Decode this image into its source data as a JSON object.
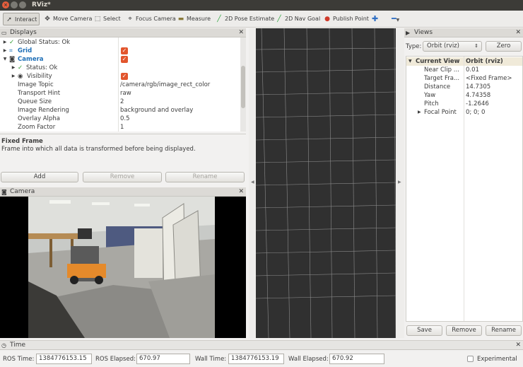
{
  "window": {
    "title": "RViz*"
  },
  "toolbar": {
    "tools": [
      {
        "icon": "cursor-icon",
        "label": "Interact",
        "active": true
      },
      {
        "icon": "move-camera-icon",
        "label": "Move Camera"
      },
      {
        "icon": "select-icon",
        "label": "Select"
      },
      {
        "icon": "focus-camera-icon",
        "label": "Focus Camera"
      },
      {
        "icon": "measure-icon",
        "label": "Measure"
      },
      {
        "icon": "pose-estimate-icon",
        "label": "2D Pose Estimate"
      },
      {
        "icon": "nav-goal-icon",
        "label": "2D Nav Goal"
      },
      {
        "icon": "publish-point-icon",
        "label": "Publish Point"
      }
    ]
  },
  "displays": {
    "title": "Displays",
    "rows": [
      {
        "key": "Global Status: Ok",
        "value": ""
      },
      {
        "key": "Grid",
        "value": ""
      },
      {
        "key": "Camera",
        "value": ""
      },
      {
        "key": "Status: Ok",
        "value": ""
      },
      {
        "key": "Visibility",
        "value": ""
      },
      {
        "key": "Image Topic",
        "value": "/camera/rgb/image_rect_color"
      },
      {
        "key": "Transport Hint",
        "value": "raw"
      },
      {
        "key": "Queue Size",
        "value": "2"
      },
      {
        "key": "Image Rendering",
        "value": "background and overlay"
      },
      {
        "key": "Overlay Alpha",
        "value": "0.5"
      },
      {
        "key": "Zoom Factor",
        "value": "1"
      }
    ],
    "help_title": "Fixed Frame",
    "help_text": "Frame into which all data is transformed before being displayed.",
    "add_label": "Add",
    "remove_label": "Remove",
    "rename_label": "Rename"
  },
  "camera_panel": {
    "title": "Camera"
  },
  "views": {
    "title": "Views",
    "type_label": "Type:",
    "type_value": "Orbit (rviz)",
    "zero_label": "Zero",
    "rows": [
      {
        "key": "Current View",
        "value": "Orbit (rviz)"
      },
      {
        "key": "Near Clip ...",
        "value": "0.01"
      },
      {
        "key": "Target Fra...",
        "value": "<Fixed Frame>"
      },
      {
        "key": "Distance",
        "value": "14.7305"
      },
      {
        "key": "Yaw",
        "value": "4.74358"
      },
      {
        "key": "Pitch",
        "value": "-1.2646"
      },
      {
        "key": "Focal Point",
        "value": "0; 0; 0"
      }
    ],
    "save_label": "Save",
    "remove_label": "Remove",
    "rename_label": "Rename"
  },
  "time": {
    "title": "Time",
    "ros_time_label": "ROS Time:",
    "ros_time": "1384776153.15",
    "ros_elapsed_label": "ROS Elapsed:",
    "ros_elapsed": "670.97",
    "wall_time_label": "Wall Time:",
    "wall_time": "1384776153.19",
    "wall_elapsed_label": "Wall Elapsed:",
    "wall_elapsed": "670.92",
    "experimental_label": "Experimental"
  }
}
